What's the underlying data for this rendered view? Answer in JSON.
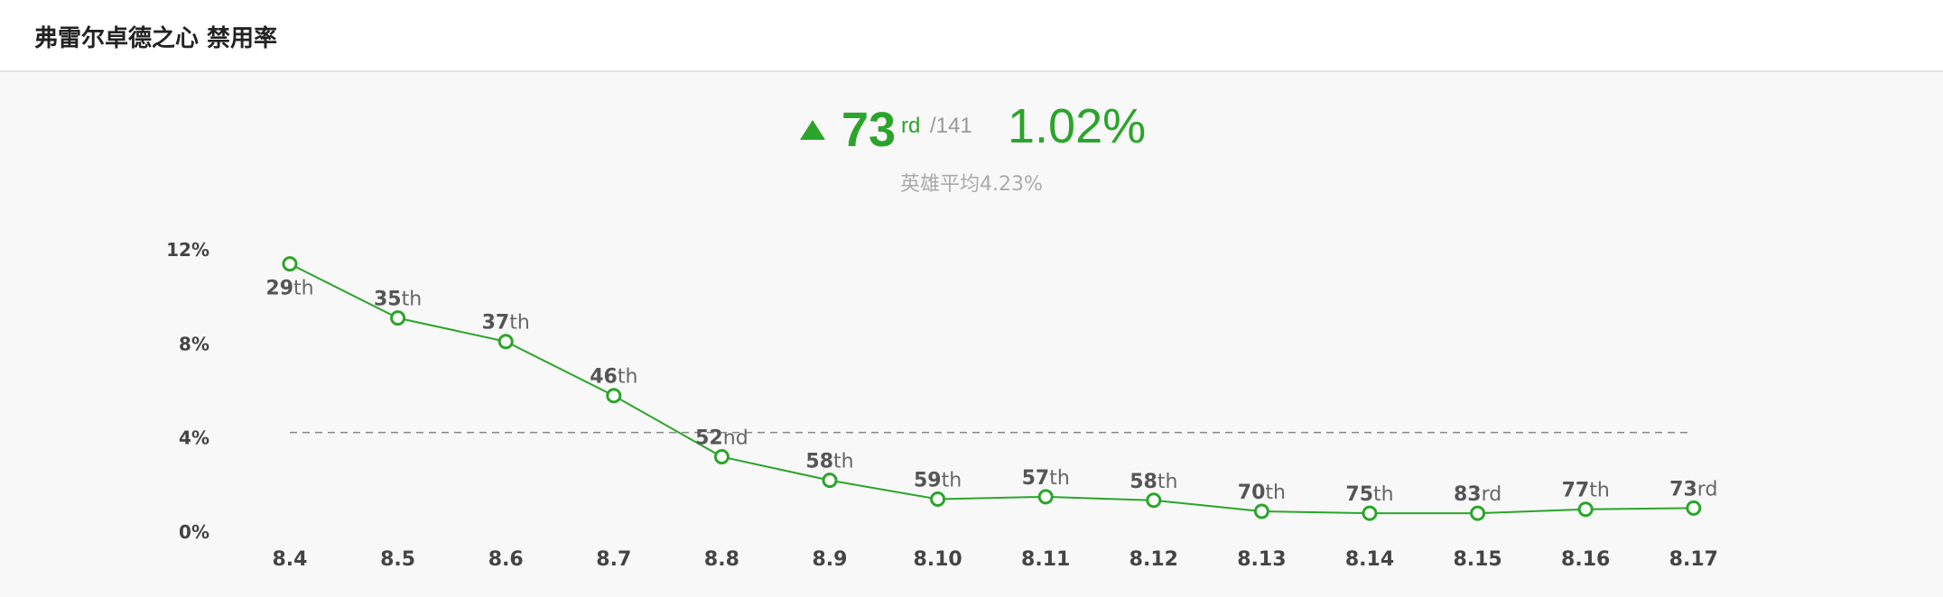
{
  "header": {
    "title": "弗雷尔卓德之心 禁用率"
  },
  "summary": {
    "rank": "73",
    "rank_suffix": "rd",
    "rank_total": "/141",
    "rate": "1.02%",
    "average": "英雄平均4.23%",
    "trend": "up"
  },
  "colors": {
    "accent": "#2aa52a",
    "average_line": "#888888"
  },
  "chart_data": {
    "type": "line",
    "title": "",
    "xlabel": "",
    "ylabel": "",
    "categories": [
      "8.4",
      "8.5",
      "8.6",
      "8.7",
      "8.8",
      "8.9",
      "8.10",
      "8.11",
      "8.12",
      "8.13",
      "8.14",
      "8.15",
      "8.16",
      "8.17"
    ],
    "series": [
      {
        "values": [
          11.4,
          9.1,
          8.1,
          5.8,
          3.2,
          2.2,
          1.4,
          1.5,
          1.35,
          0.88,
          0.8,
          0.8,
          0.97,
          1.02
        ],
        "ranks": [
          "29th",
          "35th",
          "37th",
          "46th",
          "52nd",
          "58th",
          "59th",
          "57th",
          "58th",
          "70th",
          "75th",
          "83rd",
          "77th",
          "73rd"
        ]
      }
    ],
    "average": 4.23,
    "ylim": [
      0,
      12
    ],
    "yticks": [
      "0%",
      "4%",
      "8%",
      "12%"
    ],
    "ytick_values": [
      0,
      4,
      8,
      12
    ],
    "grid": false,
    "legend": "none"
  }
}
